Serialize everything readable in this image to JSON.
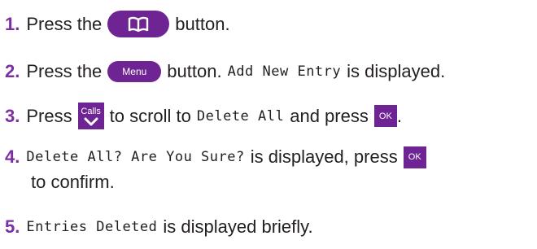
{
  "steps": [
    {
      "number": "1.",
      "before": "Press the",
      "button_icon": "phonebook-icon",
      "after": "button."
    },
    {
      "number": "2.",
      "before": "Press the",
      "button_label": "Menu",
      "middle": "button.",
      "display_text": "Add New Entry",
      "after": "is displayed."
    },
    {
      "number": "3.",
      "before": "Press",
      "calls_label": "Calls",
      "calls_icon": "chevron-down-icon",
      "middle": "to scroll to",
      "display_text": "Delete All",
      "and_press": "and press",
      "ok_label": "OK",
      "end": "."
    },
    {
      "number": "4.",
      "display_text": "Delete All? Are You Sure?",
      "middle": "is displayed, press",
      "ok_label": "OK",
      "line2": "to confirm."
    },
    {
      "number": "5.",
      "display_text": "Entries Deleted",
      "after": "is displayed briefly."
    }
  ],
  "colors": {
    "accent": "#6e2593",
    "number": "#7b2fa0",
    "text": "#231f20"
  }
}
